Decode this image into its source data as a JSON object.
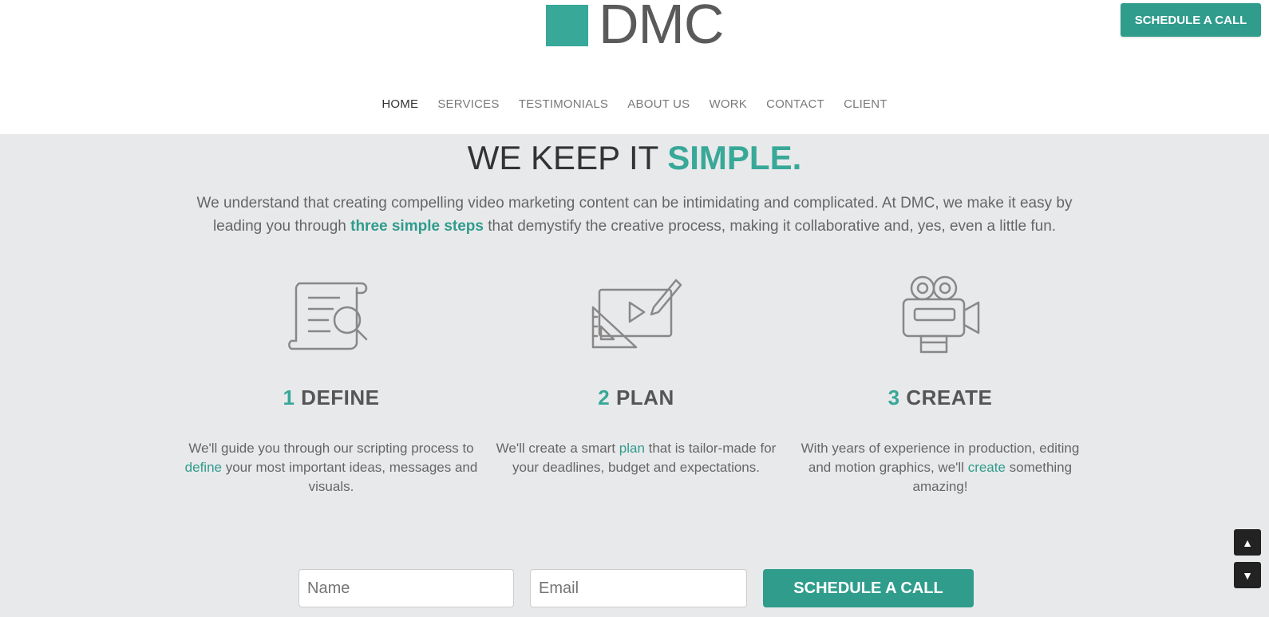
{
  "header": {
    "logo_text": "DMC",
    "cta_label": "SCHEDULE A CALL"
  },
  "nav": {
    "items": [
      "HOME",
      "SERVICES",
      "TESTIMONIALS",
      "ABOUT US",
      "WORK",
      "CONTACT",
      "CLIENT"
    ],
    "active": "HOME"
  },
  "hero": {
    "headline_plain": "WE KEEP IT ",
    "headline_accent": "SIMPLE.",
    "intro_before": "We understand that creating compelling video marketing content can be intimidating and complicated. At DMC, we make it easy by leading you through ",
    "intro_accent": "three simple steps",
    "intro_after": " that demystify the creative process, making it collaborative and, yes, even a little fun."
  },
  "steps": [
    {
      "number": "1",
      "name": "DEFINE",
      "icon": "script-magnifier-icon",
      "desc_before": "We'll guide you through our scripting process to ",
      "desc_accent": "define",
      "desc_after": " your most important ideas, messages and visuals."
    },
    {
      "number": "2",
      "name": "PLAN",
      "icon": "storyboard-pencil-icon",
      "desc_before": "We'll create a smart ",
      "desc_accent": "plan",
      "desc_after": " that is tailor-made for your deadlines, budget and expectations."
    },
    {
      "number": "3",
      "name": "CREATE",
      "icon": "film-camera-icon",
      "desc_before": "With years of experience in production, editing and motion graphics, we'll ",
      "desc_accent": "create",
      "desc_after": " something amazing!"
    }
  ],
  "form": {
    "name_placeholder": "Name",
    "email_placeholder": "Email",
    "submit_label": "SCHEDULE A CALL"
  },
  "scroll": {
    "up_glyph": "▲",
    "down_glyph": "▼"
  },
  "colors": {
    "accent": "#38a898",
    "button": "#2f9c8c",
    "background": "#e8e9eb"
  }
}
